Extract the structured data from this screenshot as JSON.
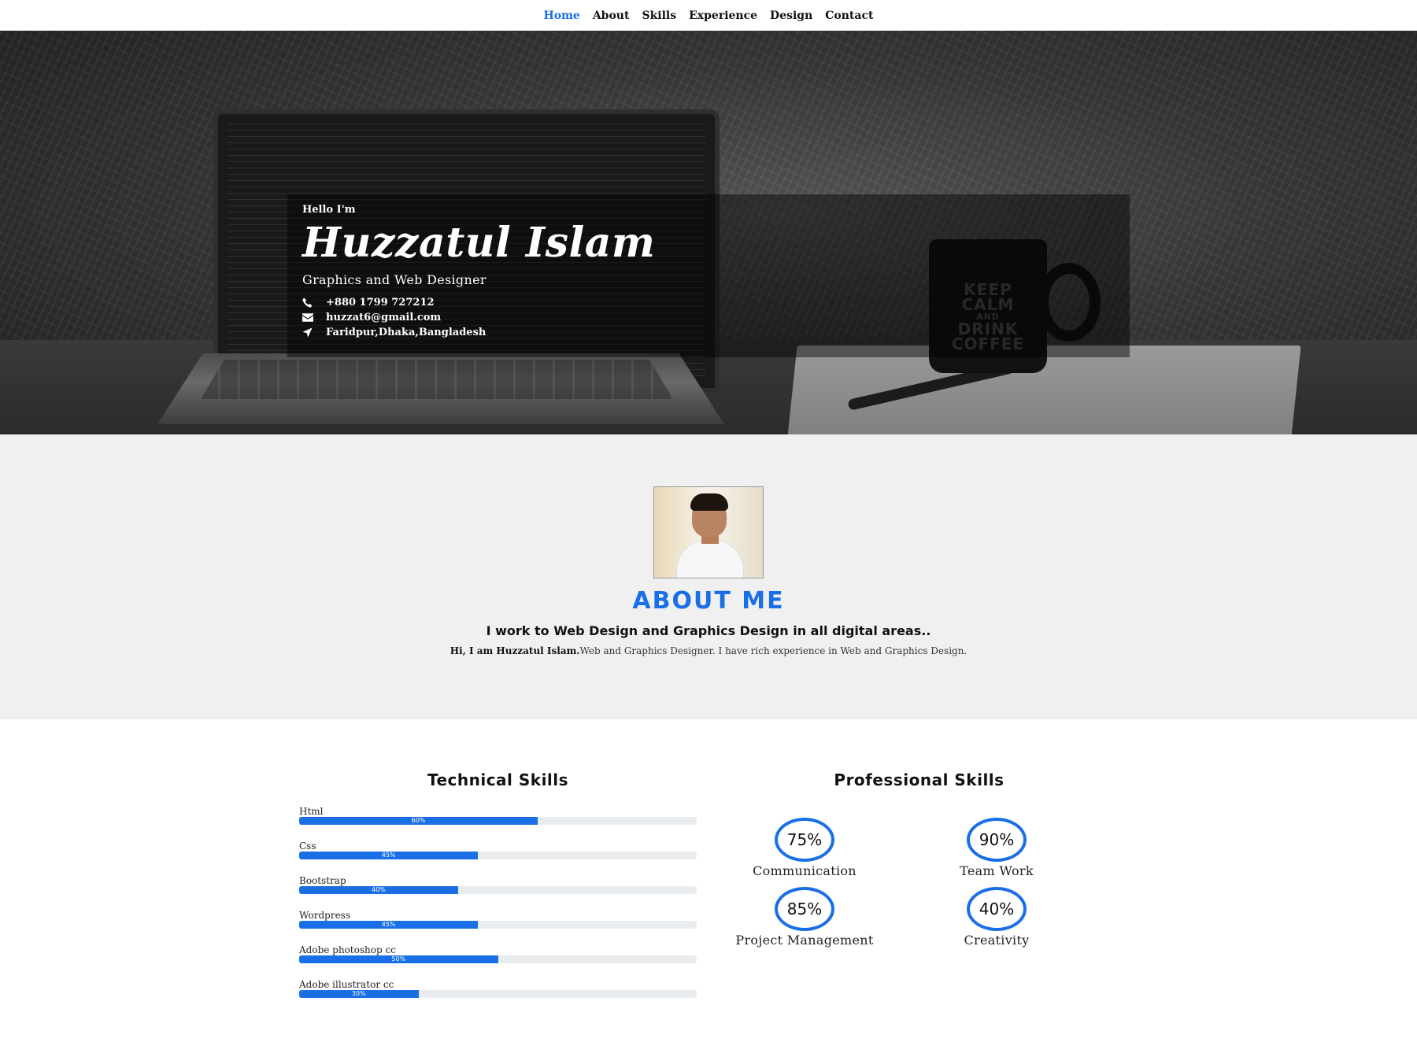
{
  "nav": {
    "items": [
      "Home",
      "About",
      "Skills",
      "Experience",
      "Design",
      "Contact"
    ],
    "active": "Home"
  },
  "hero": {
    "greeting": "Hello I'm",
    "name": "Huzzatul Islam",
    "role": "Graphics and Web Designer",
    "phone": "+880 1799 727212",
    "email": "huzzat6@gmail.com",
    "location": "Faridpur,Dhaka,Bangladesh",
    "mug_text": [
      "KEEP",
      "CALM",
      "AND",
      "DRINK",
      "COFFEE"
    ]
  },
  "about": {
    "title": "ABOUT ME",
    "subtitle": "I work to Web Design and Graphics Design in all digital areas..",
    "desc_bold": "Hi, I am Huzzatul Islam.",
    "desc_rest": "Web and Graphics Designer. I have rich experience in Web and Graphics Design."
  },
  "skills": {
    "technical_title": "Technical Skills",
    "professional_title": "Professional Skills",
    "technical": [
      {
        "name": "Html",
        "percent": 60,
        "label": "60%"
      },
      {
        "name": "Css",
        "percent": 45,
        "label": "45%"
      },
      {
        "name": "Bootstrap",
        "percent": 40,
        "label": "40%"
      },
      {
        "name": "Wordpress",
        "percent": 45,
        "label": "45%"
      },
      {
        "name": "Adobe photoshop cc",
        "percent": 50,
        "label": "50%"
      },
      {
        "name": "Adobe illustrator cc",
        "percent": 30,
        "label": "30%"
      }
    ],
    "professional": [
      {
        "name": "Communication",
        "value": "75%"
      },
      {
        "name": "Team Work",
        "value": "90%"
      },
      {
        "name": "Project Management",
        "value": "85%"
      },
      {
        "name": "Creativity",
        "value": "40%"
      }
    ]
  },
  "colors": {
    "accent": "#1a6fe6",
    "about_bg": "#f0f0f0",
    "track": "#e9ecef"
  },
  "icons": [
    "phone-icon",
    "envelope-icon",
    "location-arrow-icon"
  ]
}
